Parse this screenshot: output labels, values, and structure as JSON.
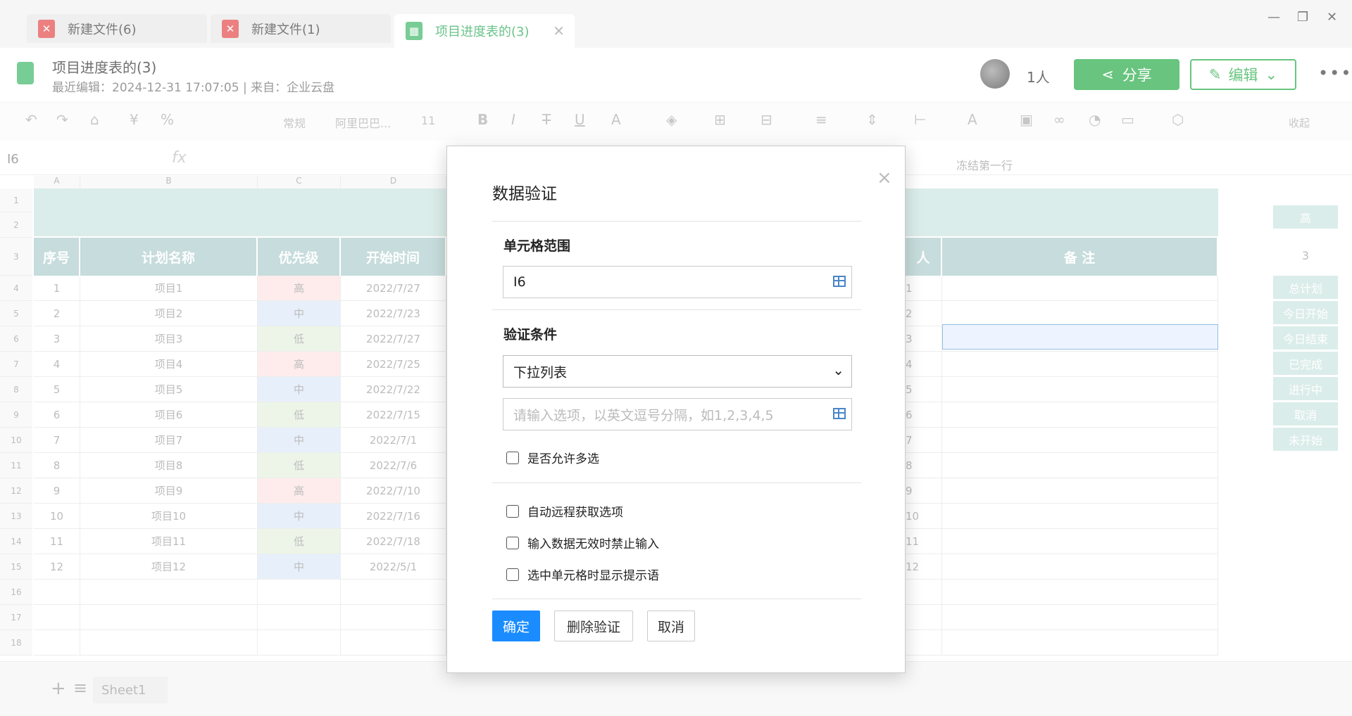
{
  "tabs": [
    {
      "label": "新建文件(6)"
    },
    {
      "label": "新建文件(1)"
    },
    {
      "label": "项目进度表的(3)"
    }
  ],
  "window": {
    "minimize": "—",
    "restore": "❐",
    "close": "✕"
  },
  "header": {
    "title": "项目进度表的(3)",
    "meta": "最近编辑：2024-12-31 17:07:05 | 来自：企业云盘",
    "people": "1人",
    "share_label": "分享",
    "edit_label": "编辑",
    "more": "•••"
  },
  "toolbar": {
    "format": "常规",
    "font": "阿里巴巴...",
    "size": "11",
    "collapse": "收起",
    "freeze": "冻结第一行"
  },
  "formula": {
    "cell_ref": "I6",
    "fx": "fx"
  },
  "sheet": {
    "columns": [
      "A",
      "B",
      "C",
      "D"
    ],
    "headers": [
      "序号",
      "计划名称",
      "优先级",
      "开始时间",
      "人",
      "备 注"
    ],
    "rows": [
      {
        "no": "1",
        "name": "项目1",
        "prio": "高",
        "start": "2022/7/27",
        "p": "1"
      },
      {
        "no": "2",
        "name": "项目2",
        "prio": "中",
        "start": "2022/7/23",
        "p": "2"
      },
      {
        "no": "3",
        "name": "项目3",
        "prio": "低",
        "start": "2022/7/27",
        "p": "3"
      },
      {
        "no": "4",
        "name": "项目4",
        "prio": "高",
        "start": "2022/7/25",
        "p": "4"
      },
      {
        "no": "5",
        "name": "项目5",
        "prio": "中",
        "start": "2022/7/22",
        "p": "5"
      },
      {
        "no": "6",
        "name": "项目6",
        "prio": "低",
        "start": "2022/7/15",
        "p": "6"
      },
      {
        "no": "7",
        "name": "项目7",
        "prio": "中",
        "start": "2022/7/1",
        "p": "7"
      },
      {
        "no": "8",
        "name": "项目8",
        "prio": "低",
        "start": "2022/7/6",
        "p": "8"
      },
      {
        "no": "9",
        "name": "项目9",
        "prio": "高",
        "start": "2022/7/10",
        "p": "9"
      },
      {
        "no": "10",
        "name": "项目10",
        "prio": "中",
        "start": "2022/7/16",
        "p": "10"
      },
      {
        "no": "11",
        "name": "项目11",
        "prio": "低",
        "start": "2022/7/18",
        "p": "11"
      },
      {
        "no": "12",
        "name": "项目12",
        "prio": "中",
        "start": "2022/5/1",
        "p": "12"
      }
    ],
    "row_numbers": [
      "1",
      "2",
      "3",
      "4",
      "5",
      "6",
      "7",
      "8",
      "9",
      "10",
      "11",
      "12",
      "13",
      "14",
      "15",
      "16",
      "17",
      "18"
    ],
    "right_panel": [
      "高",
      "3",
      "总计划",
      "今日开始",
      "今日结束",
      "已完成",
      "进行中",
      "取消",
      "未开始"
    ],
    "sheet_name": "Sheet1",
    "priority_colors": {
      "高": "#fde2e2",
      "中": "#dbe8f7",
      "低": "#e3efdc"
    }
  },
  "dialog": {
    "title": "数据验证",
    "close": "×",
    "range_label": "单元格范围",
    "range_value": "I6",
    "cond_label": "验证条件",
    "cond_value": "下拉列表",
    "options_placeholder": "请输入选项，以英文逗号分隔，如1,2,3,4,5",
    "multi": "是否允许多选",
    "auto_remote": "自动远程获取选项",
    "forbid_invalid": "输入数据无效时禁止输入",
    "show_tip": "选中单元格时显示提示语",
    "ok": "确定",
    "delete": "删除验证",
    "cancel": "取消"
  }
}
